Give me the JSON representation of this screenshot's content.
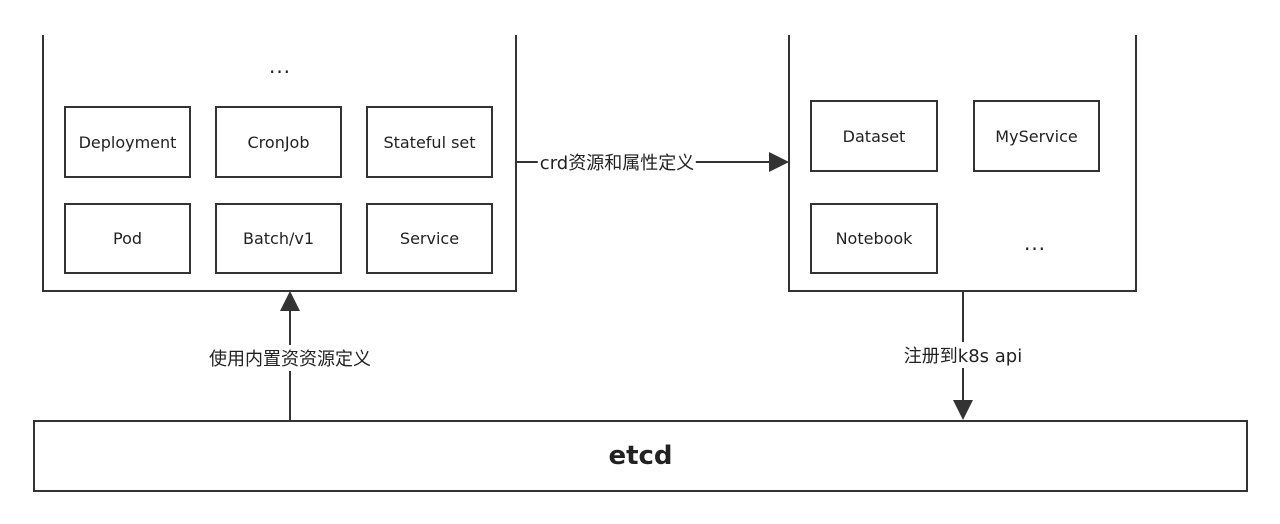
{
  "builtin_group": {
    "boxes": [
      "Deployment",
      "CronJob",
      "Stateful set",
      "Pod",
      "Batch/v1",
      "Service"
    ],
    "ellipsis": "..."
  },
  "crd_group": {
    "boxes": [
      "Dataset",
      "MyService",
      "Notebook"
    ],
    "ellipsis": "..."
  },
  "edges": {
    "crd_label": "crd资源和属性定义",
    "builtin_label": "使用内置资资源定义",
    "register_label": "注册到k8s api"
  },
  "etcd": {
    "label": "etcd"
  }
}
